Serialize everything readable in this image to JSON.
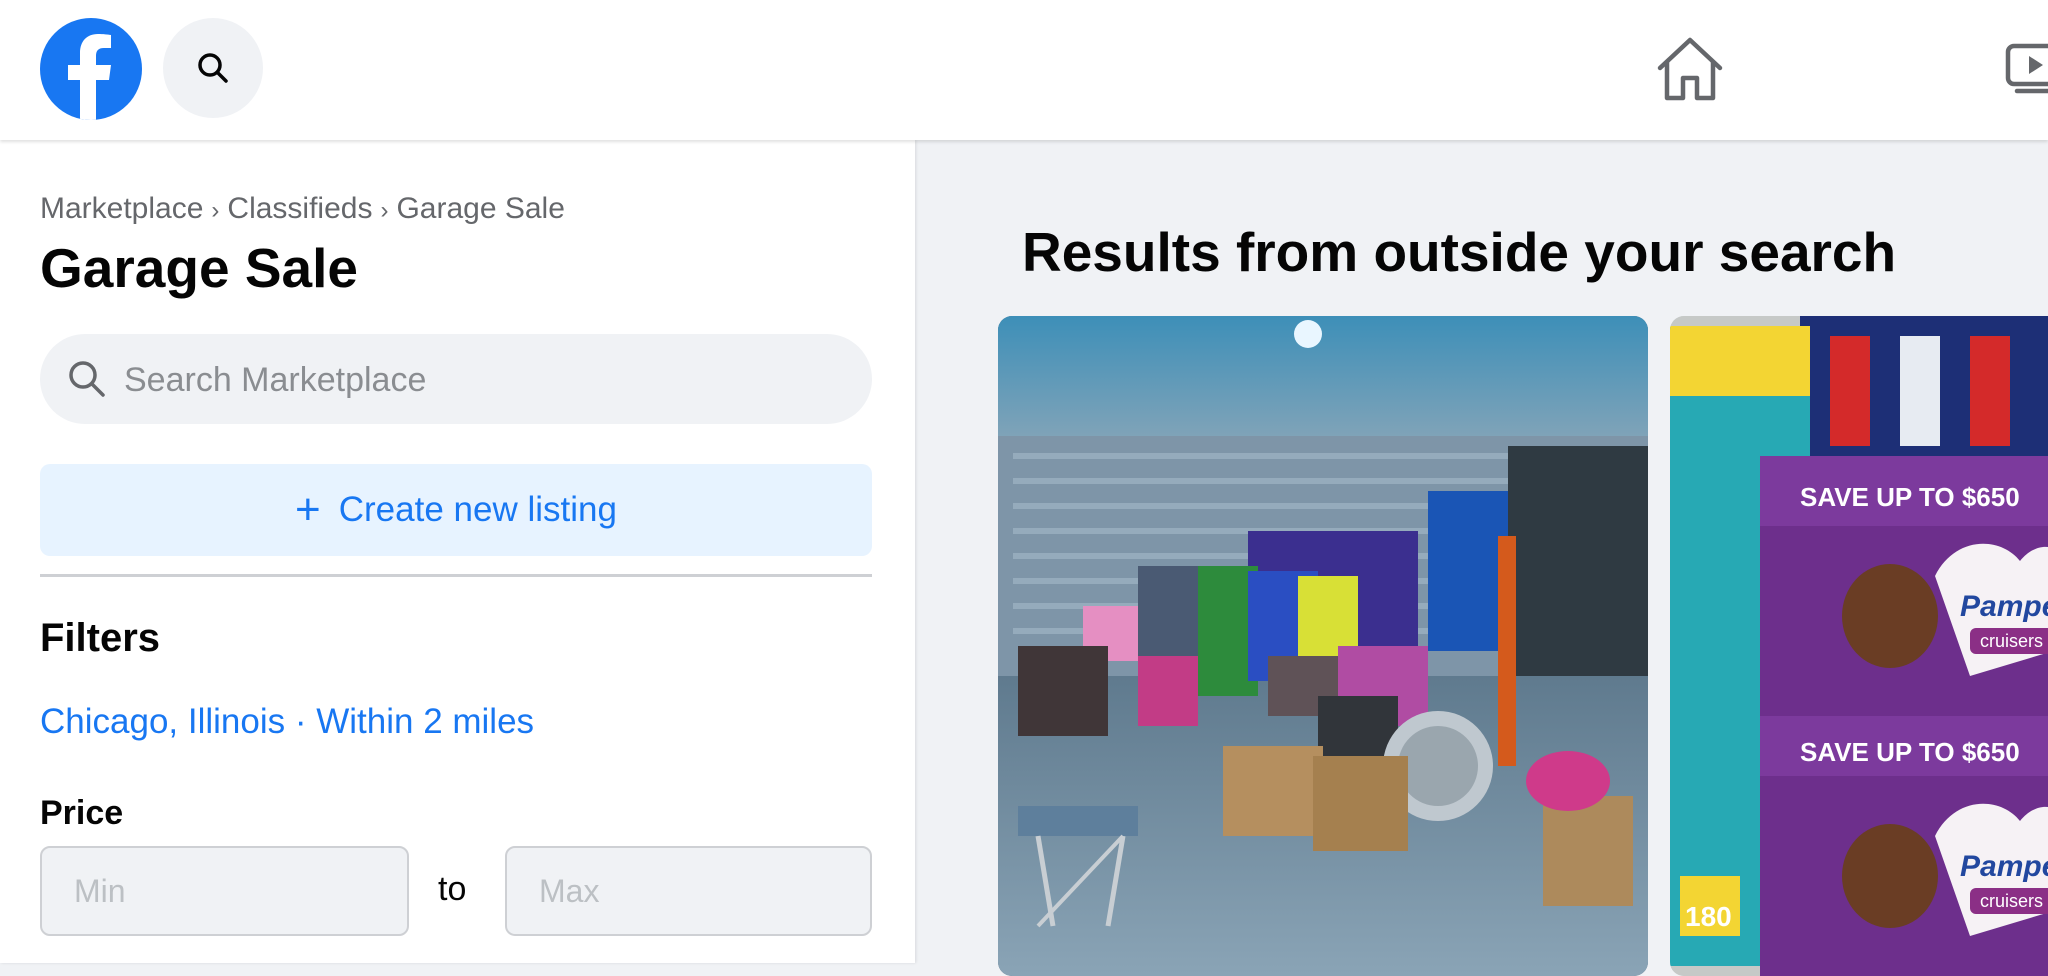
{
  "topbar": {
    "logo_icon": "facebook-logo-icon",
    "search_icon": "search-icon",
    "home_icon": "home-icon",
    "video_icon": "video-icon"
  },
  "sidebar": {
    "breadcrumb": [
      "Marketplace",
      "Classifieds",
      "Garage Sale"
    ],
    "breadcrumb_separator": "›",
    "title": "Garage Sale",
    "search": {
      "placeholder": "Search Marketplace",
      "value": ""
    },
    "create_button": {
      "icon": "+",
      "label": "Create new listing"
    },
    "filters": {
      "heading": "Filters",
      "location": "Chicago, Illinois · Within 2 miles",
      "price": {
        "label": "Price",
        "min_placeholder": "Min",
        "max_placeholder": "Max",
        "separator": "to"
      }
    }
  },
  "results": {
    "heading": "Results from outside your search",
    "listings": [
      {
        "image": "garage-sale-items-photo"
      },
      {
        "image": "pampers-diaper-boxes-photo",
        "visible_text": [
          "SAVE UP TO $650",
          "Pampers",
          "cruisers",
          "SAVE UP TO $650",
          "Pampers",
          "cruisers",
          "180"
        ]
      }
    ]
  },
  "colors": {
    "brand_blue": "#1877f2",
    "light_blue_button": "#e7f3ff",
    "background": "#f0f2f5",
    "secondary_text": "#65676b"
  }
}
